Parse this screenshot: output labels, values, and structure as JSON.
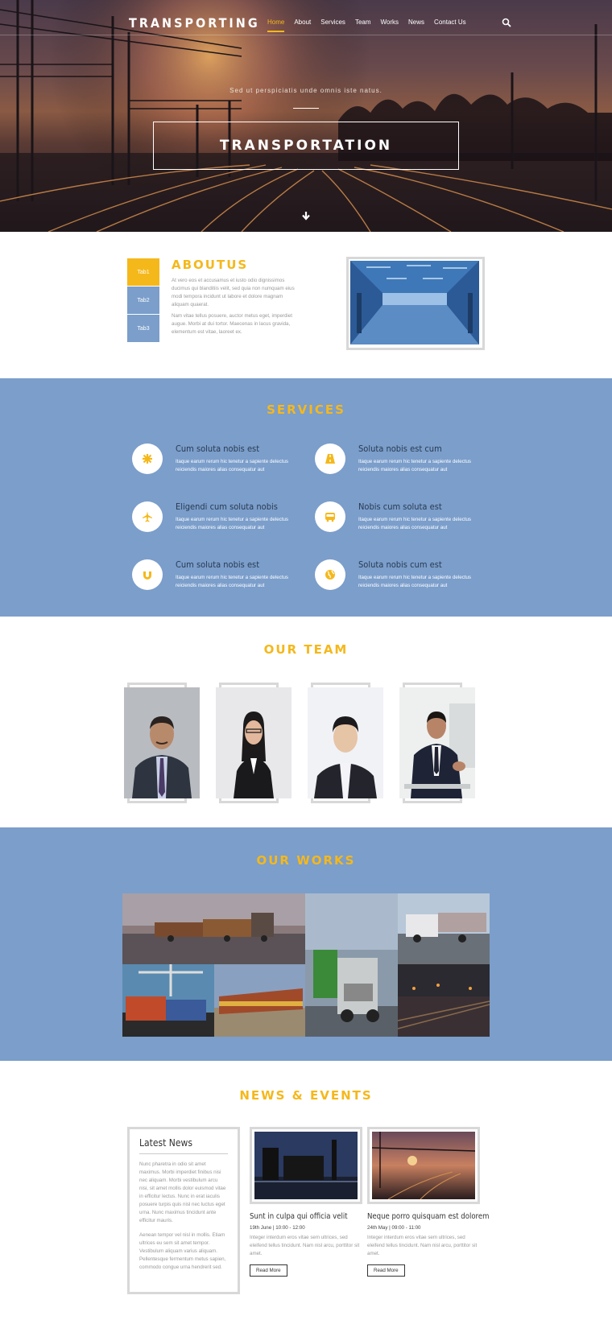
{
  "header": {
    "brand": "TRANSPORTING",
    "nav": [
      "Home",
      "About",
      "Services",
      "Team",
      "Works",
      "News",
      "Contact Us"
    ],
    "active_nav": "Home",
    "search_icon": "search-icon"
  },
  "hero": {
    "subtitle": "Sed ut perspiciatis unde omnis iste natus.",
    "title": "TRANSPORTATION",
    "scroll_icon": "arrow-down-icon"
  },
  "about": {
    "title": "ABOUTUS",
    "tabs": [
      "Tab1",
      "Tab2",
      "Tab3"
    ],
    "active_tab": "Tab1",
    "p1": "At vero eos et accusamus et iusto odio dignissimos ducimus qui blanditiis velit, sed quia non numquam eius modi tempora incidunt ut labore et dolore magnam aliquam quaerat.",
    "p2": "Nam vitae tellus posuere, auctor metus eget, imperdiet augue. Morbi at dui tortor. Maecenas in lacus gravida, elementum est vitae, laoreet ex."
  },
  "services": {
    "title": "SERVICES",
    "items": [
      {
        "title": "Cum soluta nobis est",
        "text": "Itaque earum rerum hic tenetur a sapiente delectus reiciendis maiores alias consequatur aut",
        "icon": "asterisk-icon"
      },
      {
        "title": "Soluta nobis est cum",
        "text": "Itaque earum rerum hic tenetur a sapiente delectus reiciendis maiores alias consequatur aut",
        "icon": "road-icon"
      },
      {
        "title": "Eligendi cum soluta nobis",
        "text": "Itaque earum rerum hic tenetur a sapiente delectus reiciendis maiores alias consequatur aut",
        "icon": "plane-icon"
      },
      {
        "title": "Nobis cum soluta est",
        "text": "Itaque earum rerum hic tenetur a sapiente delectus reiciendis maiores alias consequatur aut",
        "icon": "bus-icon"
      },
      {
        "title": "Cum soluta nobis est",
        "text": "Itaque earum rerum hic tenetur a sapiente delectus reiciendis maiores alias consequatur aut",
        "icon": "magnet-icon"
      },
      {
        "title": "Soluta nobis cum est",
        "text": "Itaque earum rerum hic tenetur a sapiente delectus reiciendis maiores alias consequatur aut",
        "icon": "globe-icon"
      }
    ]
  },
  "team": {
    "title": "OUR TEAM"
  },
  "works": {
    "title": "OUR WORKS"
  },
  "news": {
    "title": "NEWS & EVENTS",
    "latest_title": "Latest News",
    "latest_p1": "Nunc pharetra in odio sit amet maximus. Morbi imperdiet finibus nisi nec aliquam. Morbi vestibulum arcu nisi, sit amet mollis dolor euismod vitae in efficitur lectus. Nunc in erat iaculis posuere turpis quis nisl nec luctus eget urna. Nunc maximus tincidunt ante efficitur mauris.",
    "latest_p2": "Aenean tempor vel nisl in mollis. Etiam ultrices eu sem sit amet tempor. Vestibulum aliquam varius aliquam. Pellentesque fermentum metus sapien, commodo congue urna hendrerit sed.",
    "cards": [
      {
        "title": "Sunt in culpa qui officia velit",
        "date": "19th June | 10:00 - 12:00",
        "text": "Integer interdum eros vitae sem ultrices, sed eleifend tellus tincidunt. Nam nisl arcu, porttitor sit amet.",
        "button": "Read More"
      },
      {
        "title": "Neque porro quisquam est dolorem",
        "date": "24th May | 09:00 - 11:00",
        "text": "Integer interdum eros vitae sem ultrices, sed eleifend tellus tincidunt. Nam nisl arcu, porttitor sit amet.",
        "button": "Read More"
      }
    ]
  },
  "colors": {
    "accent": "#f5b81b",
    "section_blue": "#7b9ecb"
  }
}
